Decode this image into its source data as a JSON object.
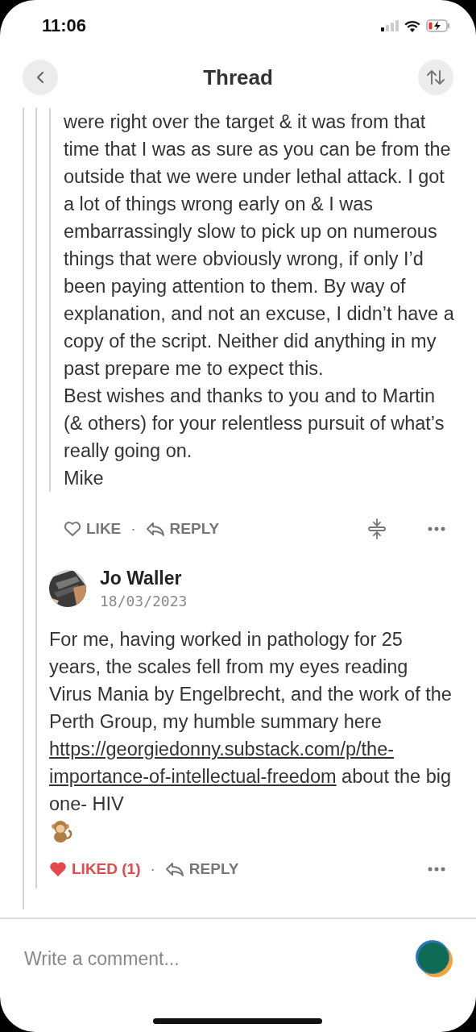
{
  "status_bar": {
    "time": "11:06"
  },
  "header": {
    "title": "Thread"
  },
  "comments": [
    {
      "kind": "continued",
      "paragraphs": [
        "were right over the target & it was from that time that I was as sure as you can be from the outside that we were under lethal attack. I got a lot of things wrong early on & I was embarrassingly slow to pick up on numerous things that were obviously wrong, if only I’d been paying attention to them. By way of explanation, and not an excuse, I didn’t have a copy of the script. Neither did anything in my past prepare me to expect this.",
        "Best wishes and thanks to you and to Martin (& others) for your relentless pursuit of what’s really going on.",
        "Mike"
      ],
      "actions": {
        "like_label": "LIKE",
        "liked": false,
        "separator": "·",
        "reply_label": "REPLY",
        "collapse": true
      }
    },
    {
      "kind": "full",
      "author": "Jo Waller",
      "date": "18/03/2023",
      "body_before": "For me, having worked in pathology for 25 years, the scales fell from my eyes reading Virus Mania by Engelbrecht, and the work of the Perth Group, my humble summary here",
      "link_lines": [
        "https://georgiedonny.substack.com/p/the-",
        "importance-of-intellectual-freedom"
      ],
      "body_after": "about the big one- HIV",
      "actions": {
        "like_label": "LIKED (1)",
        "liked": true,
        "separator": "·",
        "reply_label": "REPLY",
        "collapse": false
      }
    }
  ],
  "composer": {
    "placeholder": "Write a comment..."
  }
}
